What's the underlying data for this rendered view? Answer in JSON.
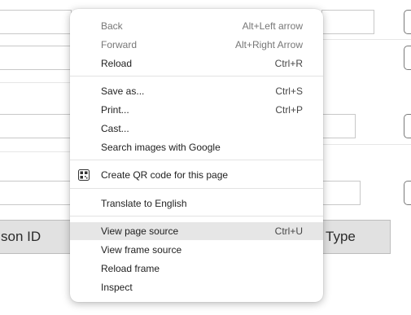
{
  "page": {
    "header_left": "son ID",
    "header_right": "Type"
  },
  "context_menu": {
    "items": [
      {
        "label": "Back",
        "shortcut": "Alt+Left arrow",
        "enabled": false
      },
      {
        "label": "Forward",
        "shortcut": "Alt+Right Arrow",
        "enabled": false
      },
      {
        "label": "Reload",
        "shortcut": "Ctrl+R",
        "enabled": true
      },
      {
        "label": "Save as...",
        "shortcut": "Ctrl+S",
        "enabled": true
      },
      {
        "label": "Print...",
        "shortcut": "Ctrl+P",
        "enabled": true
      },
      {
        "label": "Cast...",
        "shortcut": "",
        "enabled": true
      },
      {
        "label": "Search images with Google",
        "shortcut": "",
        "enabled": true
      },
      {
        "label": "Create QR code for this page",
        "shortcut": "",
        "enabled": true,
        "icon": "qr-code-icon"
      },
      {
        "label": "Translate to English",
        "shortcut": "",
        "enabled": true
      },
      {
        "label": "View page source",
        "shortcut": "Ctrl+U",
        "enabled": true,
        "highlighted": true
      },
      {
        "label": "View frame source",
        "shortcut": "",
        "enabled": true
      },
      {
        "label": "Reload frame",
        "shortcut": "",
        "enabled": true
      },
      {
        "label": "Inspect",
        "shortcut": "",
        "enabled": true
      }
    ]
  }
}
